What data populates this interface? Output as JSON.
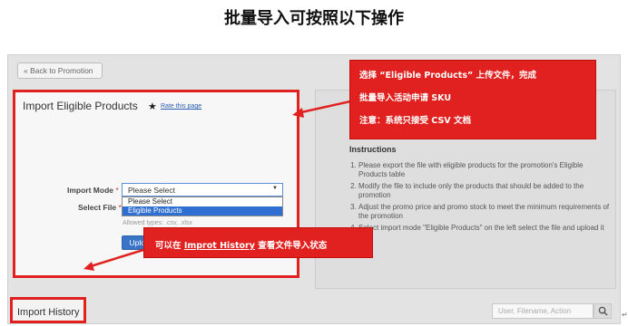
{
  "heading": "批量导入可按照以下操作",
  "toolbar": {
    "back_label": "« Back to Promotion"
  },
  "import_panel": {
    "title": "Import Eligible Products",
    "rate_link": "Rate this page",
    "import_mode": {
      "label": "Import Mode",
      "required_mark": "*",
      "selected": "Please Select",
      "options": [
        "Please Select",
        "Eligible Products"
      ]
    },
    "select_file": {
      "label": "Select File",
      "required_mark": "*"
    },
    "allowed_types": "Allowed types: .csv, .xlsx",
    "upload_label": "Upload File"
  },
  "instructions": {
    "title": "Instructions",
    "items": [
      "Please export the file with eligible products for the promotion's Eligible Products table",
      "Modify the file to include only the products that should be added to the promotion",
      "Adjust the promo price and promo stock to meet the minimum requirements of the promotion",
      "Select import mode \"Eligible Products\" on the left select the file and upload it"
    ]
  },
  "history": {
    "label": "Import History",
    "search_placeholder": "User, Filename, Action"
  },
  "callouts": {
    "top": {
      "line1": "选择 “Eligible Products” 上传文件，完成",
      "line2": "批量导入活动申请 SKU",
      "line3": "注意：系统只接受 CSV 文档"
    },
    "bottom": {
      "prefix": "可以在 ",
      "link": "Improt History",
      "suffix": " 查看文件导入状态"
    },
    "color": "#e0211f"
  }
}
